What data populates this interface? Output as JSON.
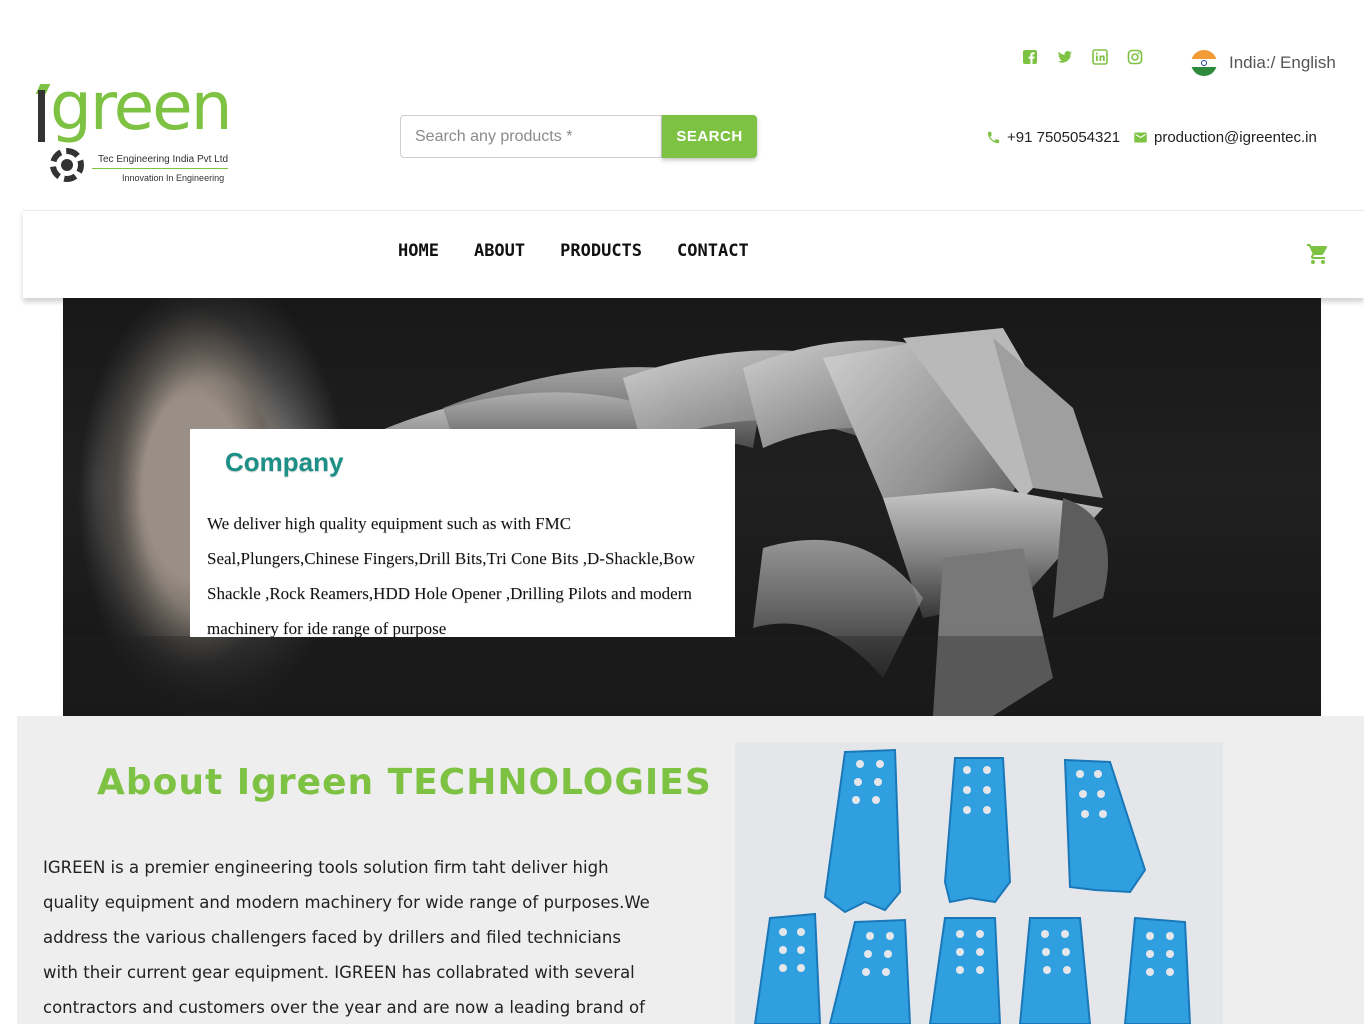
{
  "brand": {
    "logo_word": "green",
    "logo_tagline_1": "Tec Engineering India Pvt Ltd",
    "logo_tagline_2": "Innovation In Engineering",
    "accent_color": "#7dc242",
    "teal_color": "#1c8f86"
  },
  "header": {
    "search_placeholder": "Search any products *",
    "search_button": "SEARCH",
    "socials": [
      "facebook-icon",
      "twitter-icon",
      "linkedin-icon",
      "instagram-icon"
    ],
    "language": "India:/ English",
    "phone": "+91 7505054321",
    "email": "production@igreentec.in"
  },
  "nav": {
    "items": [
      {
        "label": "HOME"
      },
      {
        "label": "ABOUT"
      },
      {
        "label": "PRODUCTS"
      },
      {
        "label": "CONTACT"
      }
    ],
    "cart_icon": "cart-icon"
  },
  "hero": {
    "card_title": "Company",
    "card_text": "We deliver high quality equipment such as with FMC Seal,Plungers,Chinese Fingers,Drill Bits,Tri Cone Bits ,D-Shackle,Bow Shackle ,Rock Reamers,HDD Hole Opener ,Drilling Pilots and modern machinery for ide range of purpose"
  },
  "about": {
    "title": "About Igreen TECHNOLOGIES",
    "text": "IGREEN is a premier engineering tools solution firm taht deliver high quality equipment and modern machinery for wide range of purposes.We address the various challengers faced by drillers and filed technicians with their current gear equipment. IGREEN has collabrated with several contractors and customers over the year and are now a leading brand of drilling"
  }
}
